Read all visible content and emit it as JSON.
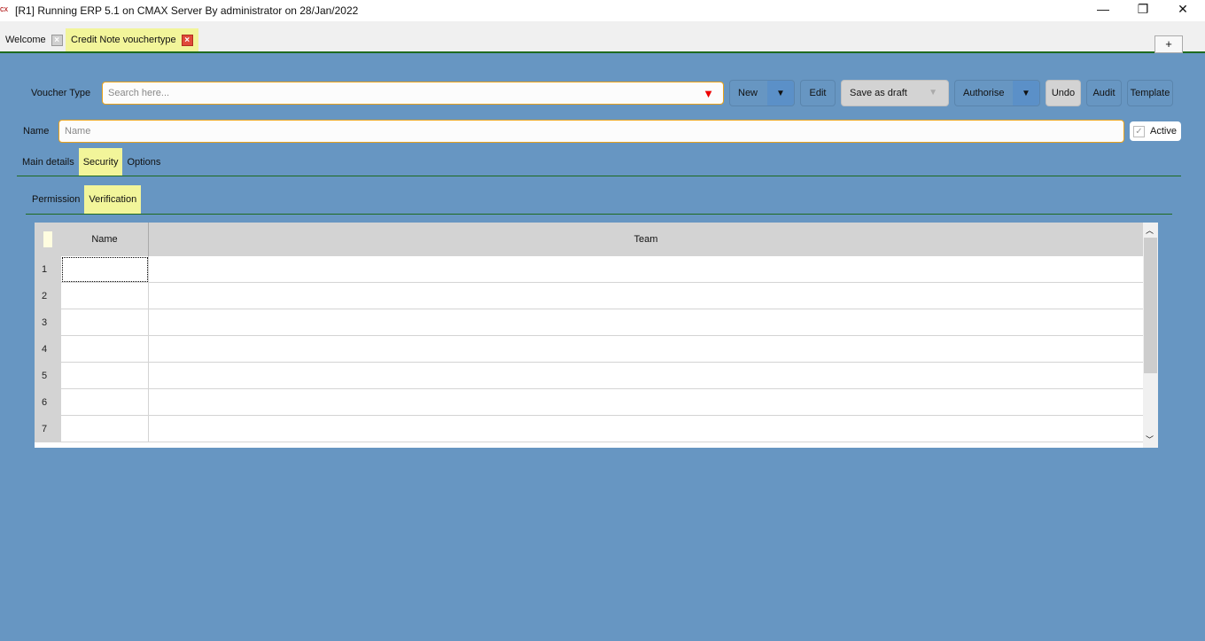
{
  "window": {
    "title": "[R1] Running ERP 5.1 on CMAX Server By administrator on 28/Jan/2022",
    "logo": "cx"
  },
  "tabs": [
    {
      "label": "Welcome",
      "active": false
    },
    {
      "label": "Credit Note vouchertype",
      "active": true
    }
  ],
  "add_tab": "+",
  "toolbar": {
    "voucher_type_label": "Voucher Type",
    "search_placeholder": "Search here...",
    "new": "New",
    "edit": "Edit",
    "save_as_draft": "Save as draft",
    "authorise": "Authorise",
    "undo": "Undo",
    "audit": "Audit",
    "template": "Template"
  },
  "name_field": {
    "label": "Name",
    "placeholder": "Name",
    "value": ""
  },
  "active": {
    "label": "Active",
    "checked": true
  },
  "main_tabs": [
    {
      "label": "Main details"
    },
    {
      "label": "Security",
      "active": true
    },
    {
      "label": "Options"
    }
  ],
  "sub_tabs": [
    {
      "label": "Permission"
    },
    {
      "label": "Verification",
      "active": true
    }
  ],
  "grid": {
    "columns": [
      "Name",
      "Team"
    ],
    "rows": [
      "1",
      "2",
      "3",
      "4",
      "5",
      "6",
      "7"
    ]
  },
  "colors": {
    "background": "#6796c2",
    "active_tab": "#f2f59a",
    "accent_border": "#e9a21a",
    "tab_underline": "#1f6b1f"
  }
}
